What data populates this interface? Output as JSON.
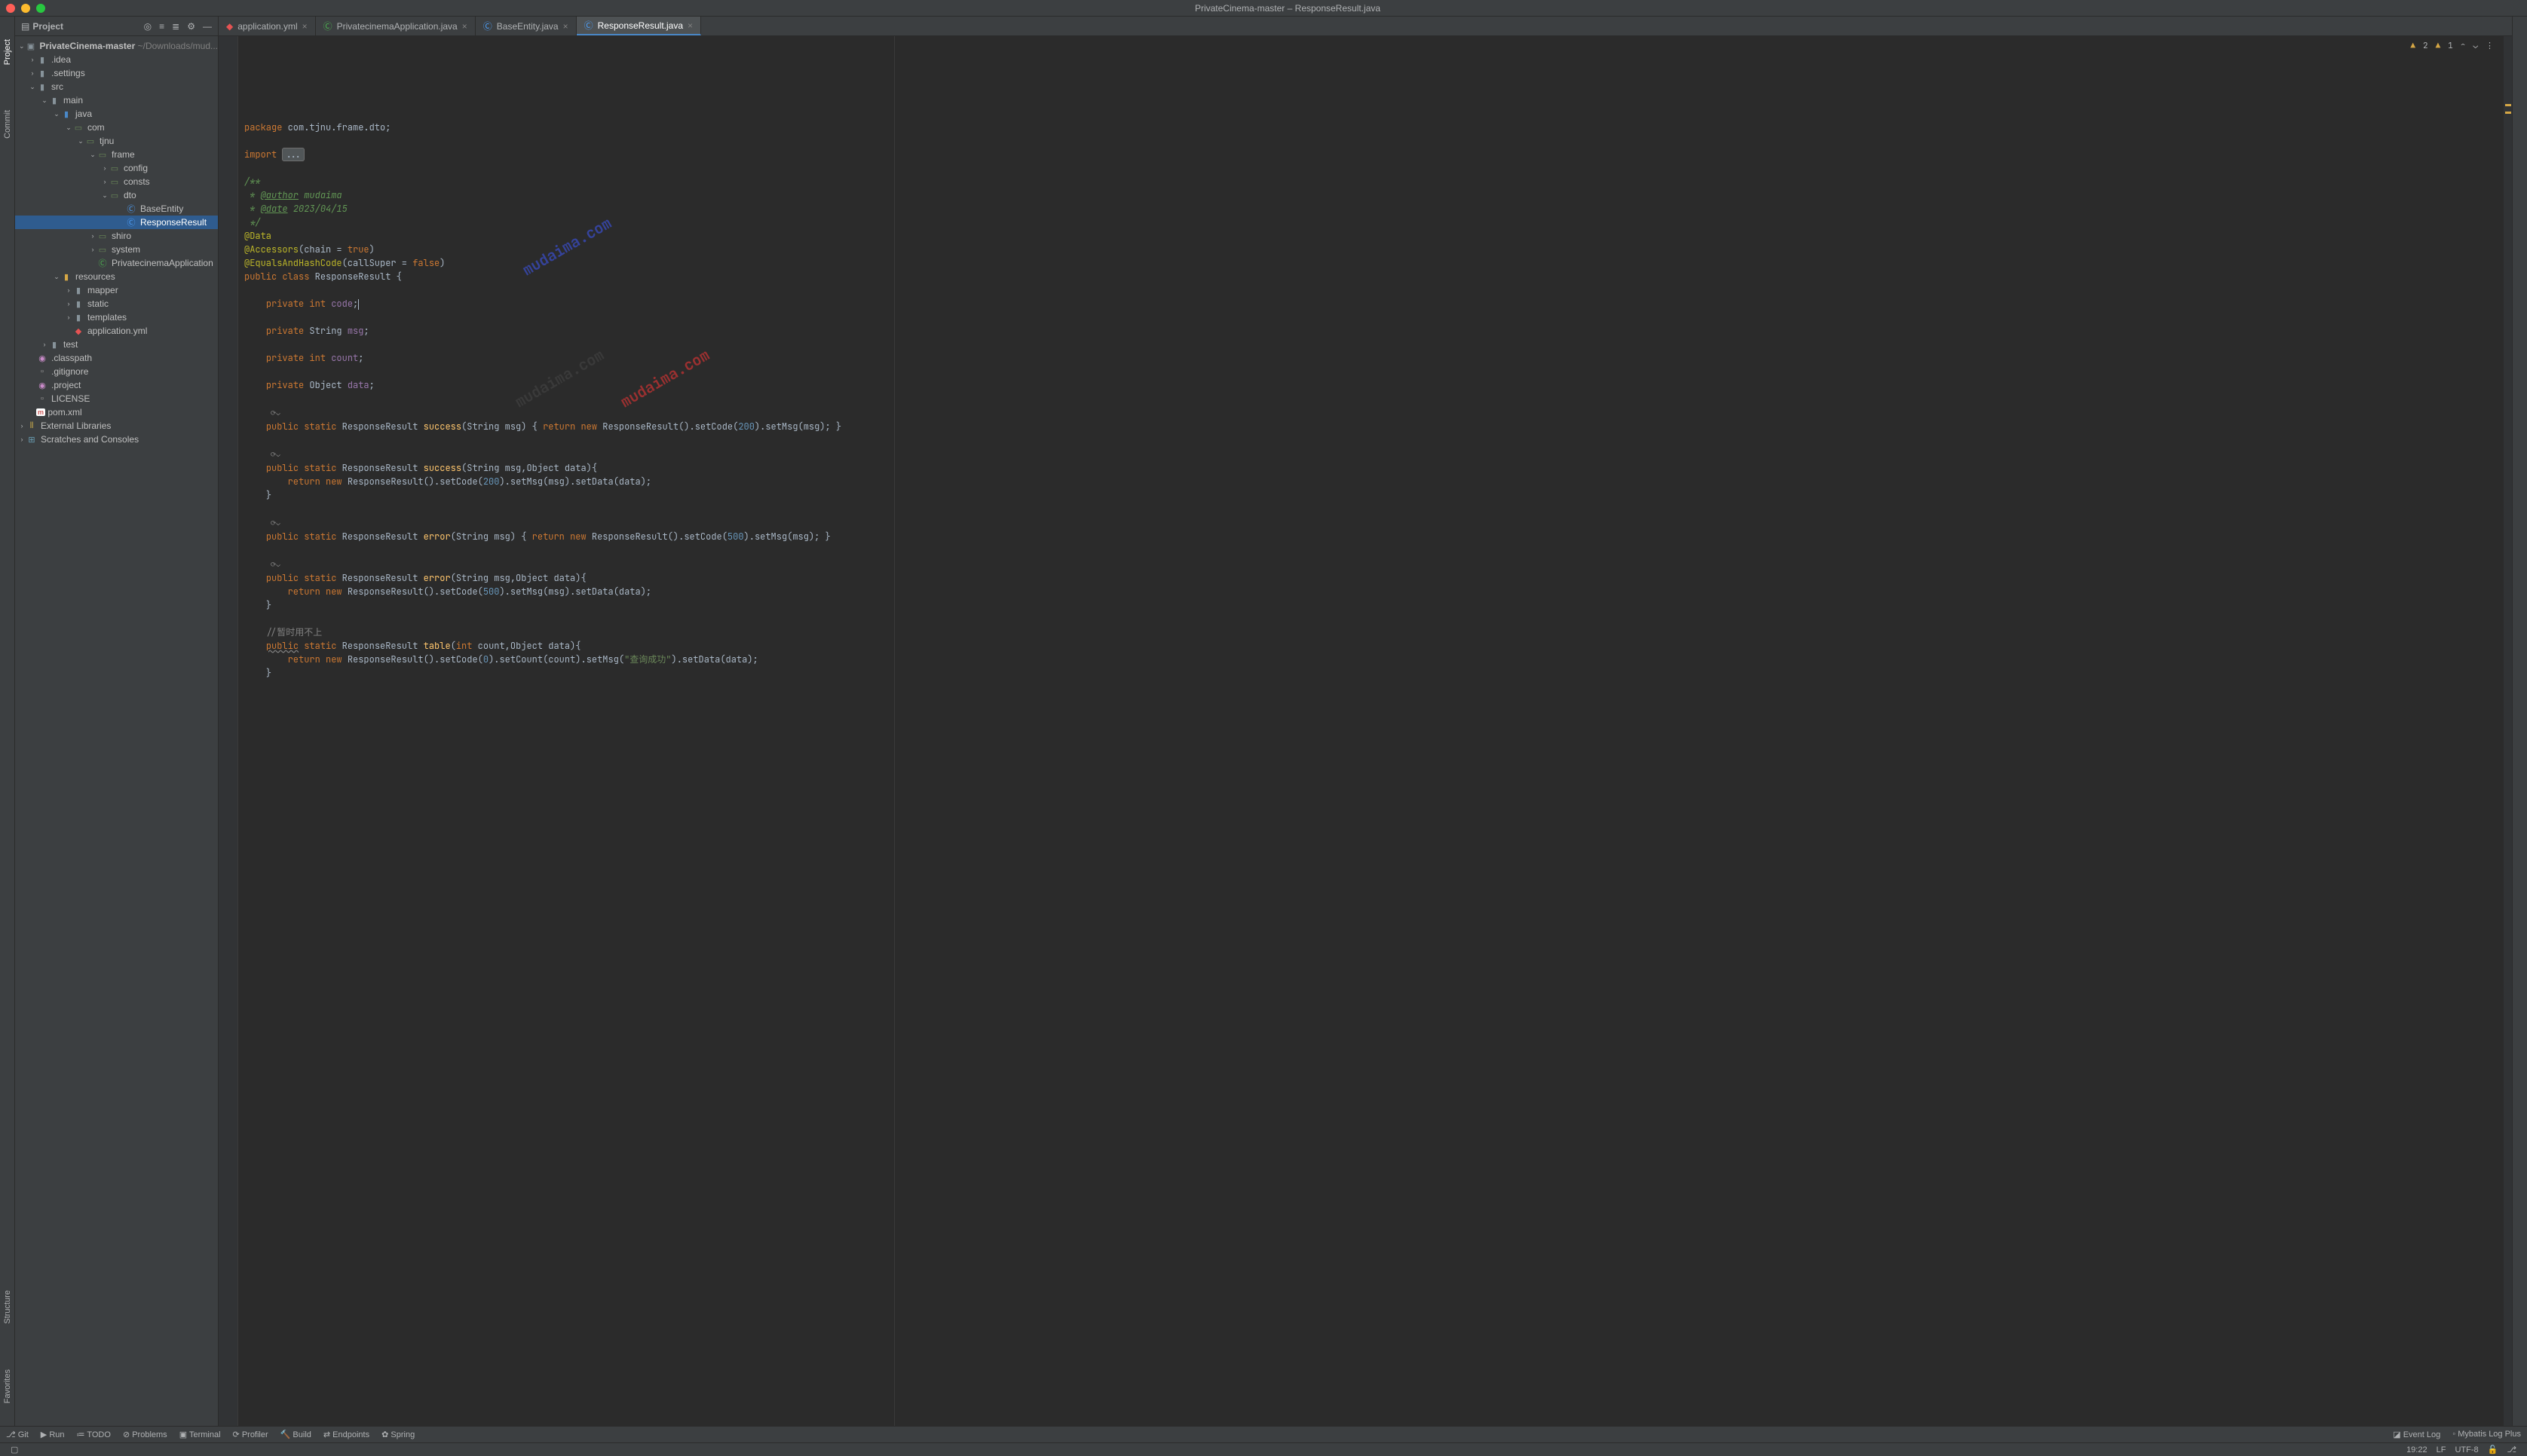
{
  "window": {
    "title": "PrivateCinema-master – ResponseResult.java"
  },
  "project_panel": {
    "title": "Project",
    "root": {
      "name": "PrivateCinema-master",
      "path": "~/Downloads/mud..."
    }
  },
  "tree": {
    "idea": ".idea",
    "settings": ".settings",
    "src": "src",
    "main": "main",
    "java": "java",
    "com": "com",
    "tjnu": "tjnu",
    "frame": "frame",
    "config": "config",
    "consts": "consts",
    "dto": "dto",
    "BaseEntity": "BaseEntity",
    "ResponseResult": "ResponseResult",
    "shiro": "shiro",
    "system": "system",
    "PrivatecinemaApplication": "PrivatecinemaApplication",
    "resources": "resources",
    "mapper": "mapper",
    "static": "static",
    "templates": "templates",
    "app_yml": "application.yml",
    "test": "test",
    "classpath": ".classpath",
    "gitignore": ".gitignore",
    "project": ".project",
    "LICENSE": "LICENSE",
    "pom": "pom.xml",
    "ext_lib": "External Libraries",
    "scratches": "Scratches and Consoles"
  },
  "tabs": [
    {
      "label": "application.yml",
      "icon": "yml"
    },
    {
      "label": "PrivatecinemaApplication.java",
      "icon": "java"
    },
    {
      "label": "BaseEntity.java",
      "icon": "class"
    },
    {
      "label": "ResponseResult.java",
      "icon": "class",
      "active": true
    }
  ],
  "indicators": {
    "warn_a": "2",
    "warn_b": "1"
  },
  "code": {
    "pkg_kw": "package",
    "pkg": "com.tjnu.frame.dto;",
    "import_kw": "import",
    "import_dots": "...",
    "jd_open": "/**",
    "jd_author_tag": "@author",
    "jd_author": "mudaima",
    "jd_date_tag": "@date",
    "jd_date": "2023/04/15",
    "jd_close": " */",
    "ann_data": "@Data",
    "ann_acc": "@Accessors",
    "ann_acc_args": "(chain = ",
    "ann_acc_true": "true",
    "ann_acc_close": ")",
    "ann_eq": "@EqualsAndHashCode",
    "ann_eq_args": "(callSuper = ",
    "ann_eq_false": "false",
    "ann_eq_close": ")",
    "class_decl_pub": "public",
    "class_decl_class": "class",
    "class_name": "ResponseResult",
    "private": "private",
    "int": "int",
    "String": "String",
    "Object": "Object",
    "f_code": "code",
    "f_msg": "msg",
    "f_count": "count",
    "f_data": "data",
    "public": "public",
    "static": "static",
    "new": "new",
    "return": "return",
    "m_success": "success",
    "m_error": "error",
    "m_table": "table",
    "m_setCode": "setCode",
    "m_setMsg": "setMsg",
    "m_setData": "setData",
    "m_setCount": "setCount",
    "n200": "200",
    "n500": "500",
    "n0": "0",
    "p_msg": "(String msg)",
    "p_msg_data": "(String msg,Object data)",
    "p_int_data": "(",
    "p_int": "int",
    "p_countp": " count,Object data)",
    "cmt_todo": "//暂时用不上",
    "query_ok": "\"查询成功\""
  },
  "left_rail": {
    "project": "Project",
    "commit": "Commit",
    "structure": "Structure",
    "favorites": "Favorites"
  },
  "bottom_tools": {
    "git": "Git",
    "run": "Run",
    "todo": "TODO",
    "problems": "Problems",
    "terminal": "Terminal",
    "profiler": "Profiler",
    "build": "Build",
    "endpoints": "Endpoints",
    "spring": "Spring",
    "eventlog": "Event Log",
    "mybatis": "Mybatis Log Plus"
  },
  "status": {
    "pos": "19:22",
    "lf": "LF",
    "enc": "UTF-8"
  },
  "watermark": {
    "text": "mudaima.com"
  }
}
